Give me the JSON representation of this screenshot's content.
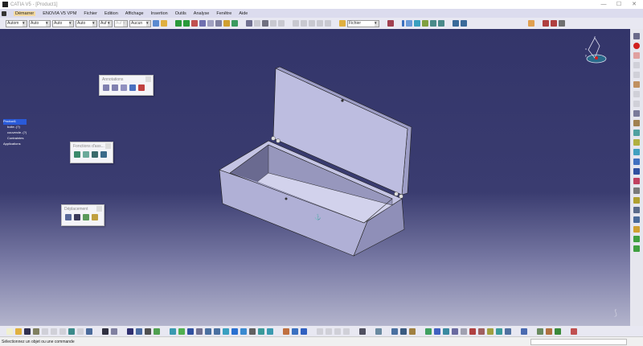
{
  "window": {
    "title": "CATIA V5 - [Product1]",
    "controls": [
      "—",
      "☐",
      "✕"
    ]
  },
  "menu": [
    "Démarrer",
    "ENOVIA V5 VPM",
    "Fichier",
    "Edition",
    "Affichage",
    "Insertion",
    "Outils",
    "Analyse",
    "Fenêtre",
    "Aide"
  ],
  "toolbar": {
    "selects": [
      {
        "value": "Autom",
        "disabled": false
      },
      {
        "value": "Auto",
        "disabled": false
      },
      {
        "value": "Auto",
        "disabled": false
      },
      {
        "value": "Auto",
        "disabled": false
      },
      {
        "value": "Auf",
        "disabled": false
      },
      {
        "value": "Auf",
        "disabled": true
      },
      {
        "value": "Aucun",
        "disabled": false
      }
    ],
    "fichier_select": "Fichier"
  },
  "tree": {
    "items": [
      "Product1",
      "boite..(?)",
      "couvercle..(?)",
      "Contraintes",
      "Applications"
    ]
  },
  "panels": {
    "annotations": {
      "title": "Annotations"
    },
    "fonctions": {
      "title": "Fonctions d'ass..."
    },
    "deplacement": {
      "title": "Déplacement"
    }
  },
  "compass": {
    "axes": [
      "x",
      "y",
      "z"
    ]
  },
  "status": {
    "message": "Sélectionnez un objet ou une commande"
  },
  "colors": {
    "viewport_top": "#33356a",
    "viewport_bottom": "#b3b4cc",
    "part": "#bdbde0",
    "menu_bg": "#dcdcee"
  }
}
